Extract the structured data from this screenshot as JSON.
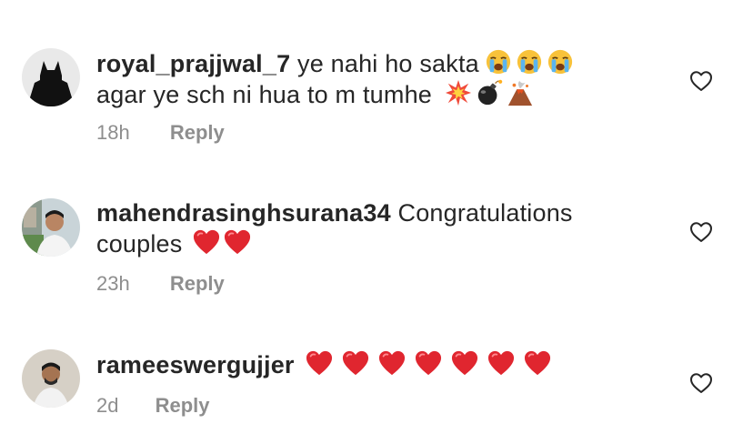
{
  "comments": [
    {
      "username": "royal_prajjwal_7",
      "text_line1": "ye nahi ho sakta",
      "text_line2": "agar ye sch ni hua to m tumhe",
      "emojis_line1": [
        "loudly-crying-face-emoji",
        "loudly-crying-face-emoji",
        "loudly-crying-face-emoji"
      ],
      "emojis_line2": [
        "collision-emoji",
        "bomb-emoji",
        "volcano-emoji"
      ],
      "time": "18h",
      "reply_label": "Reply"
    },
    {
      "username": "mahendrasinghsurana34",
      "text_line1": "Congratulations",
      "text_line2": "couples",
      "emojis_line2": [
        "red-heart-emoji",
        "red-heart-emoji"
      ],
      "time": "23h",
      "reply_label": "Reply"
    },
    {
      "username": "rameeswergujjer",
      "emojis_line1": [
        "red-heart-emoji",
        "red-heart-emoji",
        "red-heart-emoji",
        "red-heart-emoji",
        "red-heart-emoji",
        "red-heart-emoji",
        "red-heart-emoji"
      ],
      "time": "2d",
      "reply_label": "Reply"
    }
  ],
  "colors": {
    "text": "#262626",
    "meta": "#8e8e8e",
    "heart_red": "#e0262f"
  }
}
